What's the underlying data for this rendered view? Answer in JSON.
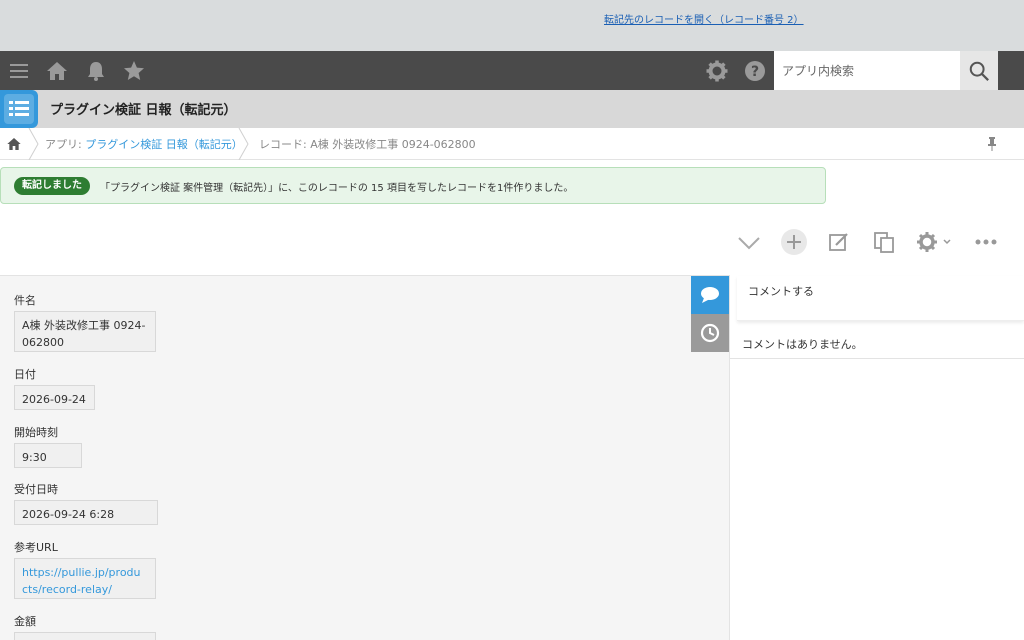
{
  "header": {
    "icons": [
      "menu-icon",
      "home-icon",
      "bell-icon",
      "star-icon",
      "gear-icon",
      "help-icon",
      "search-icon"
    ],
    "search_placeholder": "アプリ内検索"
  },
  "app": {
    "title": "プラグイン検証 日報（転記元）"
  },
  "breadcrumb": {
    "app_prefix": "アプリ: ",
    "app_link": "プラグイン検証 日報（転記元）",
    "record": "レコード: A棟 外装改修工事 0924-062800"
  },
  "notice": {
    "badge": "転記しました",
    "message": "「プラグイン検証 案件管理（転記先）」に、このレコードの 15 項目を写したレコードを1件作りました。",
    "link": "転記先のレコードを開く（レコード番号 2）"
  },
  "fields": [
    {
      "label": "件名",
      "value_line1": "A棟 外装改修工事 0924-",
      "value_line2": "062800"
    },
    {
      "label": "日付",
      "value": "2026-09-24"
    },
    {
      "label": "開始時刻",
      "value": "9:30"
    },
    {
      "label": "受付日時",
      "value": "2026-09-24 6:28"
    },
    {
      "label": "参考URL",
      "value_line1": "https://pullie.jp/produ",
      "value_line2": "cts/record-relay/"
    },
    {
      "label": "金額",
      "value": ""
    }
  ],
  "comments": {
    "input_placeholder": "コメントする",
    "empty": "コメントはありません。"
  },
  "colors": {
    "header_bg": "#4a4a4a",
    "accent": "#3498db",
    "notice_bg": "#e8f5e9",
    "badge_bg": "#2e7d32"
  }
}
